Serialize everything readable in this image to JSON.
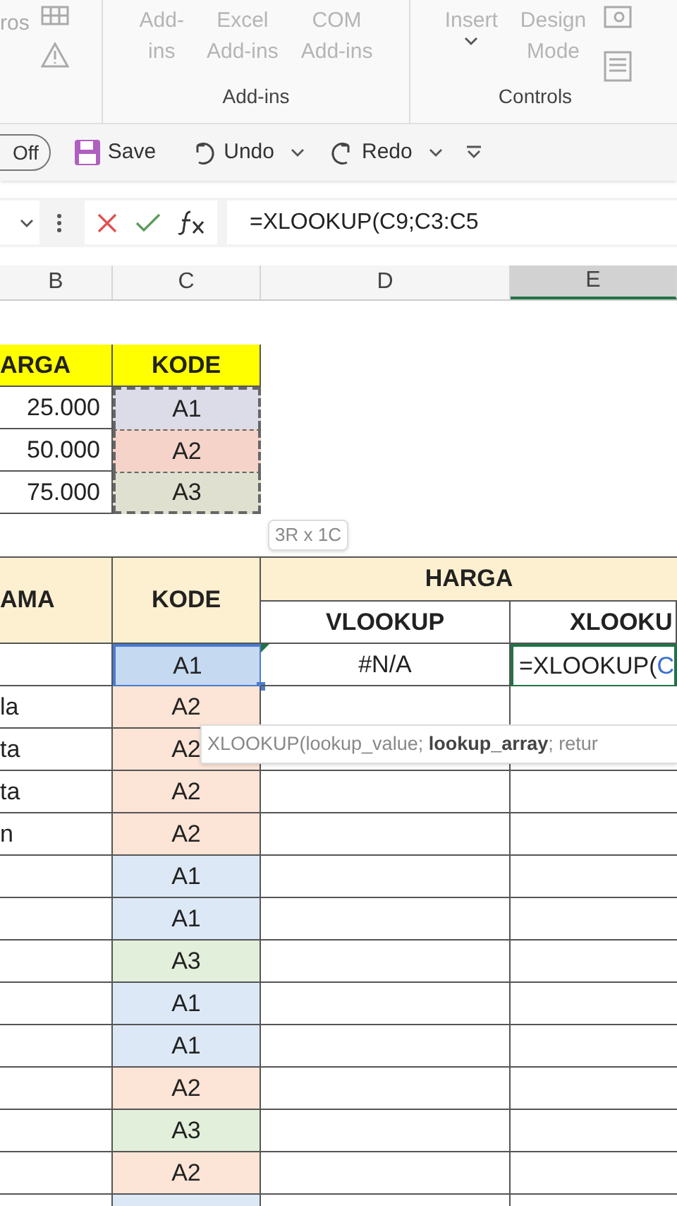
{
  "ribbon": {
    "partial_label": "ros",
    "groups": [
      {
        "label": "Add-ins",
        "buttons": [
          {
            "lines": [
              "Add-",
              "ins"
            ],
            "disabled": true,
            "dropdown": false
          },
          {
            "lines": [
              "Excel",
              "Add-ins"
            ],
            "disabled": true,
            "dropdown": false
          },
          {
            "lines": [
              "COM",
              "Add-ins"
            ],
            "disabled": true,
            "dropdown": false
          }
        ]
      },
      {
        "label": "Controls",
        "buttons": [
          {
            "lines": [
              "Insert"
            ],
            "disabled": true,
            "dropdown": true
          },
          {
            "lines": [
              "Design",
              "Mode"
            ],
            "disabled": true,
            "dropdown": false
          }
        ]
      }
    ]
  },
  "quick_access": {
    "autosave_label": "Off",
    "autosave_on": false,
    "items": [
      {
        "kind": "save",
        "label": "Save",
        "dropdown": false
      },
      {
        "kind": "undo",
        "label": "Undo",
        "dropdown": true
      },
      {
        "kind": "redo",
        "label": "Redo",
        "dropdown": true
      }
    ]
  },
  "formula_bar": {
    "formula": "=XLOOKUP(C9;C3:C5"
  },
  "columns": [
    {
      "label": "B",
      "selected": false
    },
    {
      "label": "C",
      "selected": false
    },
    {
      "label": "D",
      "selected": false
    },
    {
      "label": "E",
      "selected": true
    }
  ],
  "lookup_table": {
    "headers": [
      "ARGA",
      "KODE"
    ],
    "rows": [
      {
        "price": "25.000",
        "code": "A1",
        "color": "#dcdce8"
      },
      {
        "price": "50.000",
        "code": "A2",
        "color": "#f5d3c8"
      },
      {
        "price": "75.000",
        "code": "A3",
        "color": "#dfe0cf"
      }
    ]
  },
  "range_tip": "3R x 1C",
  "main_table": {
    "name_header": "AMA",
    "code_header": "KODE",
    "price_header": "HARGA",
    "sub_headers": [
      "VLOOKUP",
      "XLOOKU"
    ],
    "rows": [
      {
        "code": "A1",
        "color": "#c5d9f1",
        "selected": true,
        "vlookup": "#N/A",
        "xlookup_formula": "=XLOOKUP(",
        "xlookup_ref": "C"
      },
      {
        "name": "la",
        "code": "A2",
        "color": "#fce4d6",
        "selected": false
      },
      {
        "name": "ta",
        "code": "A2",
        "color": "#fce4d6",
        "selected": false
      },
      {
        "name": "ta",
        "code": "A2",
        "color": "#fce4d6",
        "selected": false
      },
      {
        "name": "n",
        "code": "A2",
        "color": "#fce4d6",
        "selected": false
      },
      {
        "code": "A1",
        "color": "#dde8f7",
        "selected": false
      },
      {
        "code": "A1",
        "color": "#dde8f7",
        "selected": false
      },
      {
        "code": "A3",
        "color": "#e2efda",
        "selected": false
      },
      {
        "code": "A1",
        "color": "#dde8f7",
        "selected": false
      },
      {
        "code": "A1",
        "color": "#dde8f7",
        "selected": false
      },
      {
        "code": "A2",
        "color": "#fce4d6",
        "selected": false
      },
      {
        "code": "A3",
        "color": "#e2efda",
        "selected": false
      },
      {
        "code": "A2",
        "color": "#fce4d6",
        "selected": false
      },
      {
        "color": "#dde8f7",
        "selected": false
      }
    ]
  },
  "function_tip": "XLOOKUP(lookup_value; **lookup_array**; retur"
}
